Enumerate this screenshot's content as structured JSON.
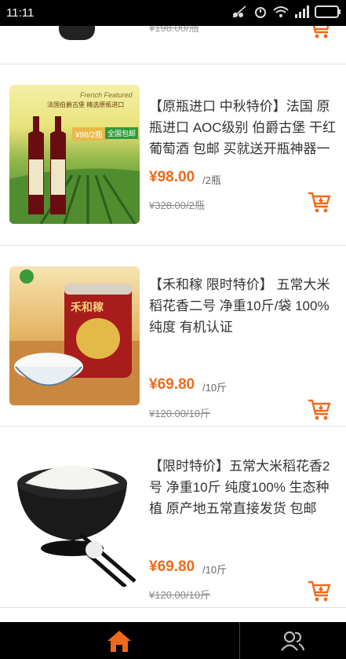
{
  "status_bar": {
    "time": "11:11"
  },
  "products": [
    {
      "title": "【原瓶进口 中秋特价】法国 原瓶进口 AOC级别 伯爵古堡 干红葡萄酒 包邮 买就送开瓶神器一",
      "price": "¥98.00",
      "unit": "/2瓶",
      "old_price": "¥328.00/2瓶",
      "image_title": "French Featured",
      "image_subtitle": "法国伯爵古堡 精选原瓶进口",
      "image_price": "¥98/2瓶",
      "image_badge": "全国包邮"
    },
    {
      "title": "【禾和稼 限时特价】 五常大米 稻花香二号 净重10斤/袋 100% 纯度 有机认证",
      "price": "¥69.80",
      "unit": "/10斤",
      "old_price": "¥120.00/10斤",
      "image_brand": "禾和稼"
    },
    {
      "title": "【限时特价】五常大米稻花香2号 净重10斤 纯度100% 生态种植 原产地五常直接发货 包邮",
      "price": "¥69.80",
      "unit": "/10斤",
      "old_price": "¥120.00/10斤"
    }
  ],
  "partial_item": {
    "old_price": "¥198.00/瓶"
  },
  "tabbar": {
    "home_icon": "home-icon",
    "account_icon": "people-icon"
  },
  "colors": {
    "accent": "#ef6a1a",
    "status_bar": "#000000",
    "tab_bar": "#000000"
  }
}
